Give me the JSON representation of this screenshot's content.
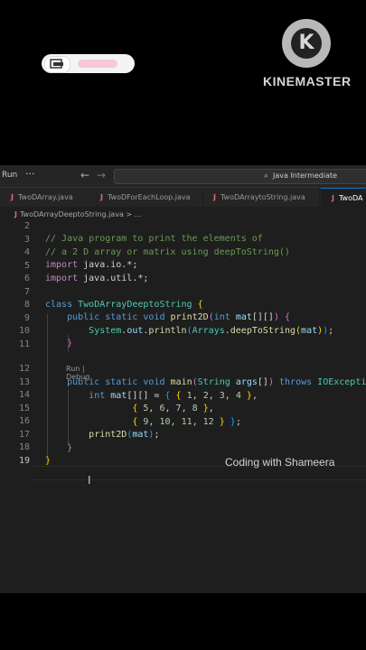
{
  "overlay": {
    "brand": "KINEMASTER",
    "logo_letter": "K"
  },
  "titlebar": {
    "menu_run": "Run",
    "menu_more": "···",
    "nav_back": "←",
    "nav_forward": "→",
    "search_icon": "⌕",
    "search_text": "Java Intermediate"
  },
  "tabs": [
    {
      "label": "TwoDArray.java",
      "active": false
    },
    {
      "label": "TwoDForEachLoop.java",
      "active": false
    },
    {
      "label": "TwoDArraytoString.java",
      "active": false
    },
    {
      "label": "TwoDA",
      "active": true
    }
  ],
  "file_icon": "J",
  "breadcrumb": "TwoDArrayDeeptoString.java > ...",
  "line_numbers": [
    "2",
    "3",
    "4",
    "5",
    "6",
    "7",
    "8",
    "9",
    "10",
    "11",
    "12",
    "13",
    "14",
    "15",
    "16",
    "17",
    "18",
    "19"
  ],
  "code": {
    "l3_comment": "// Java program to print the elements of",
    "l4_comment": "// a 2 D array or matrix using deepToString()",
    "import_kw": "import",
    "import_io": " java.io.*;",
    "import_util": " java.util.*;",
    "class_kw": "class",
    "class_name": "TwoDArrayDeeptoString",
    "public_kw": "public",
    "static_kw": "static",
    "void_kw": "void",
    "print2d_fn": "print2D",
    "int_kw": "int",
    "mat_var": "mat",
    "system_cls": "System",
    "out_var": "out",
    "println_fn": "println",
    "arrays_cls": "Arrays",
    "deep_fn": "deepToString",
    "lens": "Run | Debug",
    "main_fn": "main",
    "string_cls": "String",
    "args_var": "args",
    "throws_kw": "throws",
    "ioexc_cls": "IOException",
    "row1": [
      "1",
      "2",
      "3",
      "4"
    ],
    "row2": [
      "5",
      "6",
      "7",
      "8"
    ],
    "row3": [
      "9",
      "10",
      "11",
      "12"
    ]
  },
  "watermark": "Coding with Shameera"
}
